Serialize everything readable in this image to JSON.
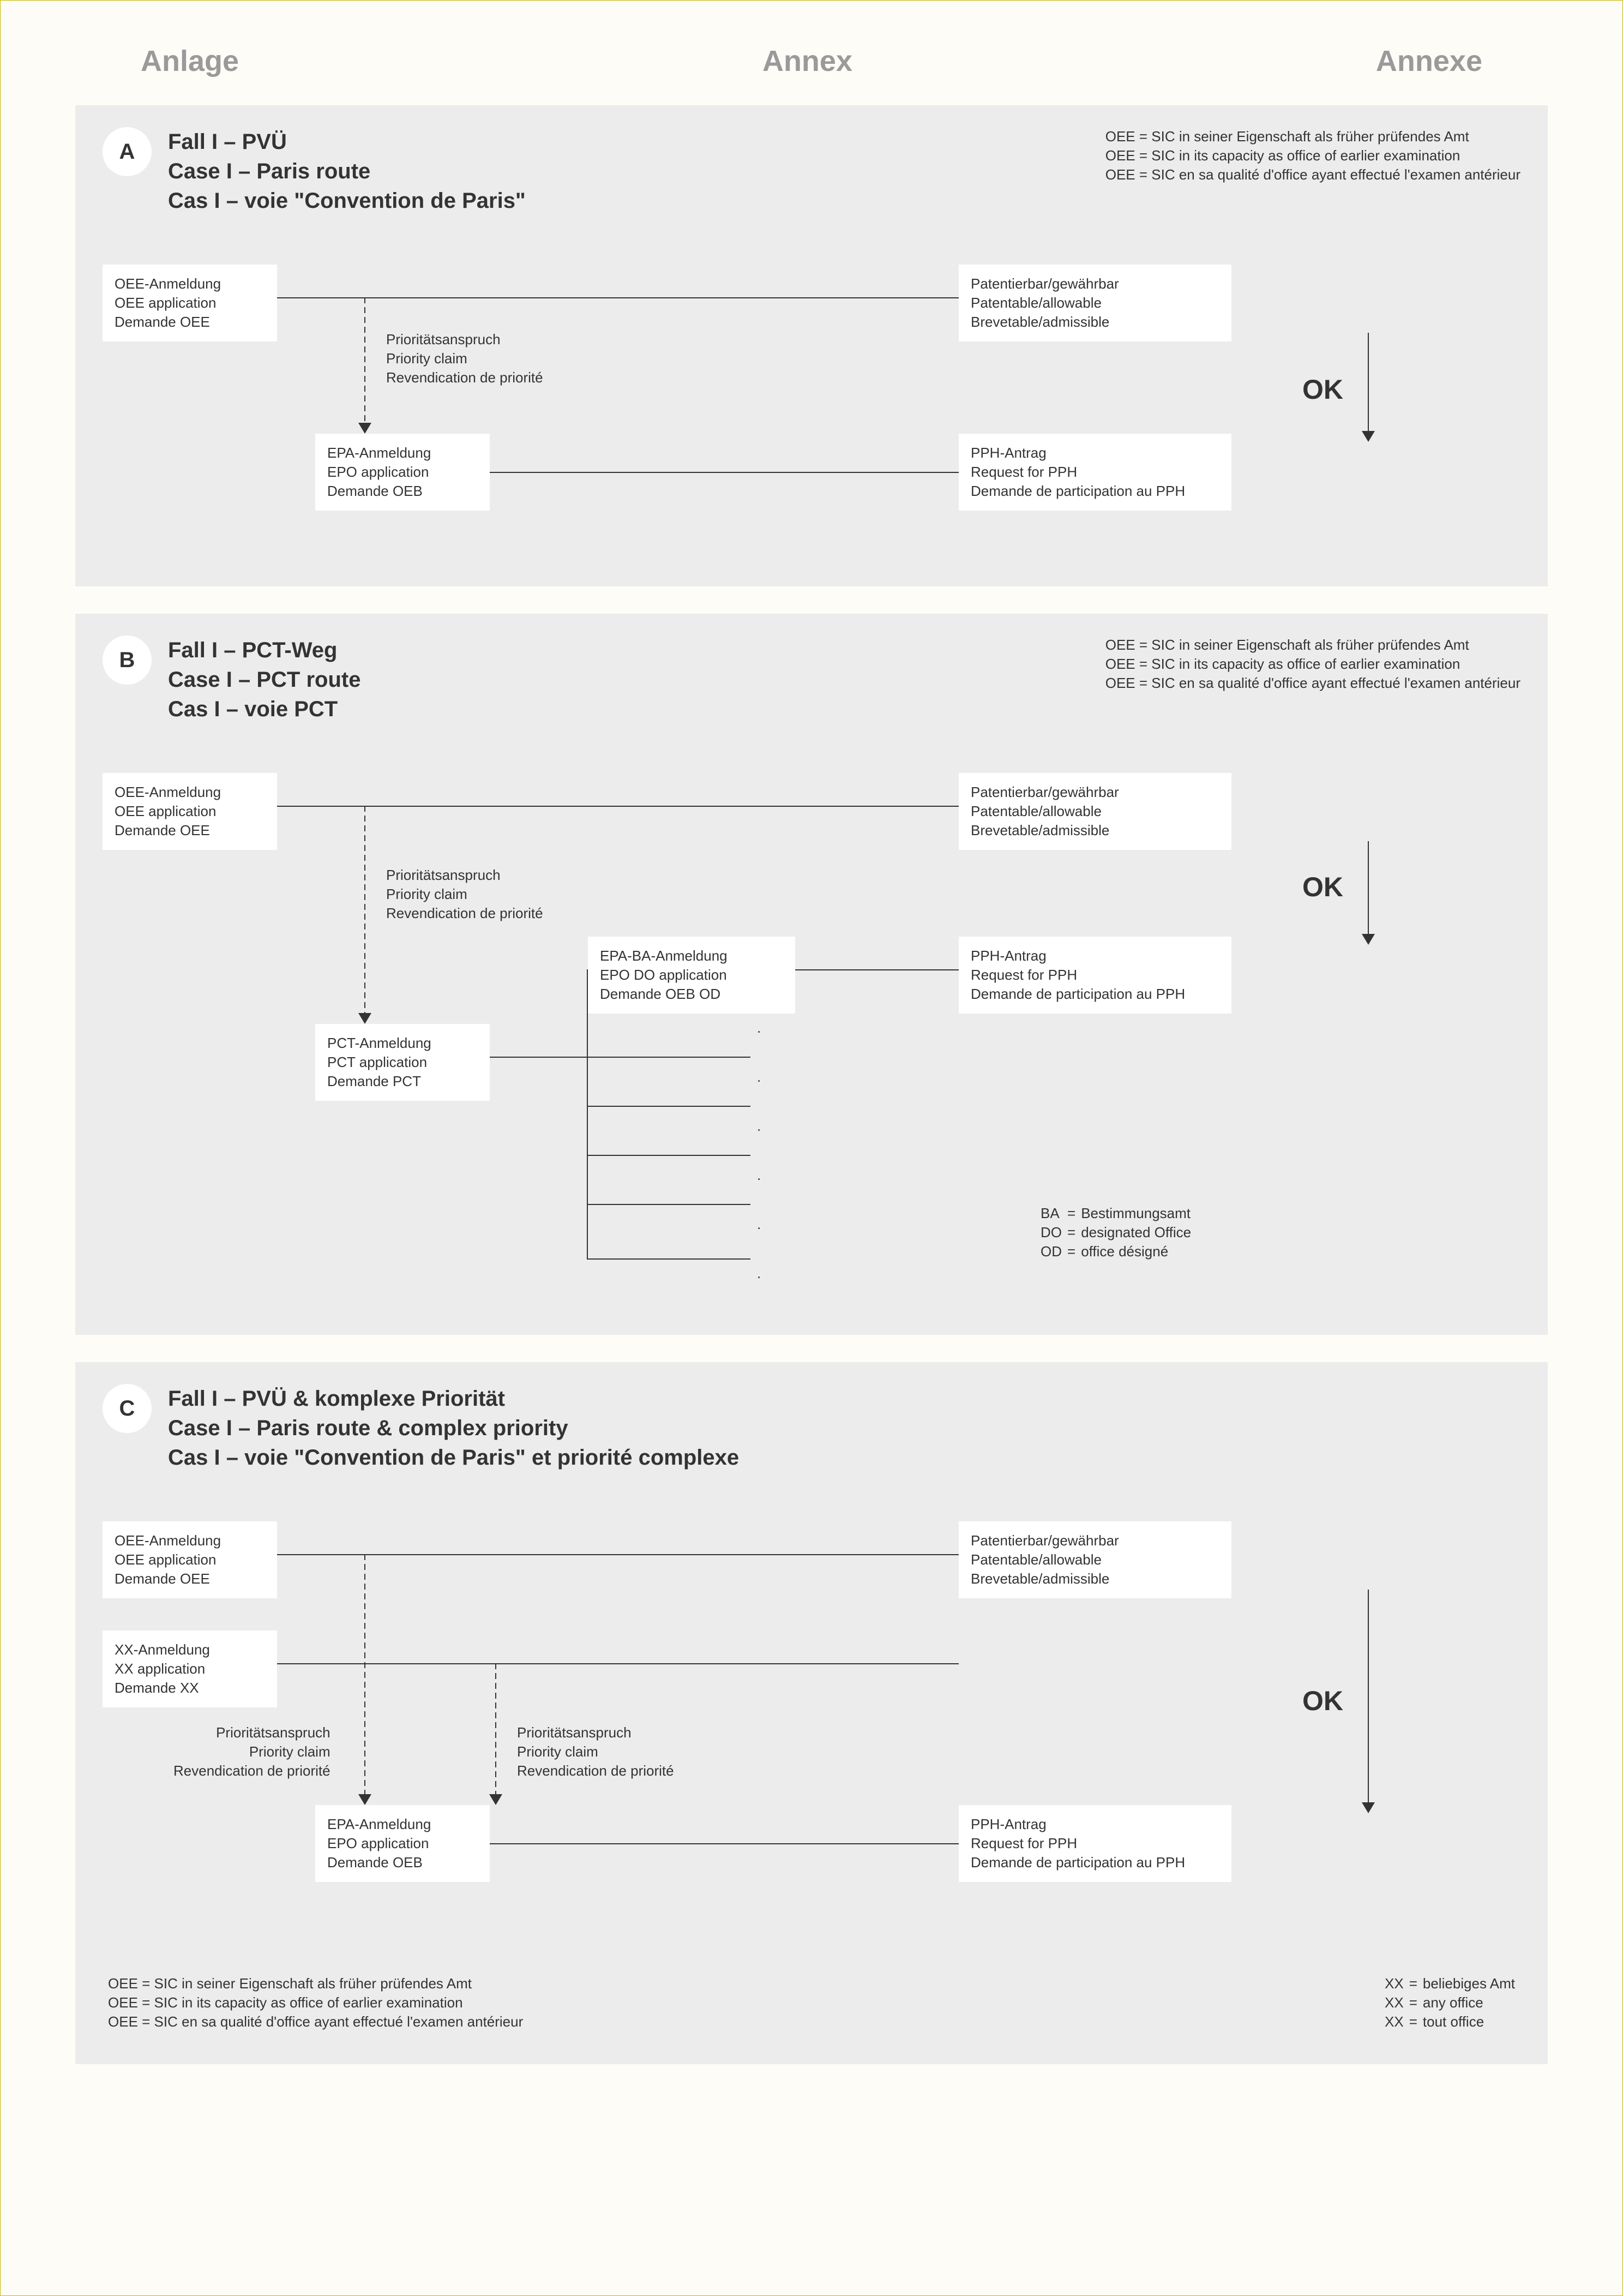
{
  "header": {
    "de": "Anlage",
    "en": "Annex",
    "fr": "Annexe"
  },
  "common": {
    "oee_defs": [
      "OEE = SIC in seiner Eigenschaft als früher prüfendes Amt",
      "OEE = SIC in its capacity as office of earlier examination",
      "OEE = SIC en sa qualité d'office ayant effectué l'examen antérieur"
    ],
    "oee_app": [
      "OEE-Anmeldung",
      "OEE application",
      "Demande OEE"
    ],
    "patentable": [
      "Patentierbar/gewährbar",
      "Patentable/allowable",
      "Brevetable/admissible"
    ],
    "priority": [
      "Prioritätsanspruch",
      "Priority claim",
      "Revendication de priorité"
    ],
    "epo_app": [
      "EPA-Anmeldung",
      "EPO application",
      "Demande OEB"
    ],
    "pph": [
      "PPH-Antrag",
      "Request for PPH",
      "Demande de participation au PPH"
    ],
    "ok": "OK"
  },
  "panelA": {
    "letter": "A",
    "titles": [
      "Fall I – PVÜ",
      "Case I – Paris route",
      "Cas I  – voie \"Convention de Paris\""
    ]
  },
  "panelB": {
    "letter": "B",
    "titles": [
      "Fall I – PCT-Weg",
      "Case I – PCT route",
      "Cas I – voie PCT"
    ],
    "pct_app": [
      "PCT-Anmeldung",
      "PCT application",
      "Demande PCT"
    ],
    "epo_do": [
      "EPA-BA-Anmeldung",
      "EPO DO application",
      "Demande OEB OD"
    ],
    "ba_defs": [
      [
        "BA",
        "=",
        "Bestimmungsamt"
      ],
      [
        "DO",
        "=",
        "designated Office"
      ],
      [
        "OD",
        "=",
        "office désigné"
      ]
    ]
  },
  "panelC": {
    "letter": "C",
    "titles": [
      "Fall I – PVÜ & komplexe Priorität",
      "Case I – Paris route & complex priority",
      "Cas I – voie \"Convention de Paris\" et priorité complexe"
    ],
    "xx_app": [
      "XX-Anmeldung",
      "XX application",
      "Demande XX"
    ],
    "xx_defs": [
      [
        "XX",
        "=",
        "beliebiges Amt"
      ],
      [
        "XX",
        "=",
        "any office"
      ],
      [
        "XX",
        "=",
        "tout office"
      ]
    ]
  }
}
